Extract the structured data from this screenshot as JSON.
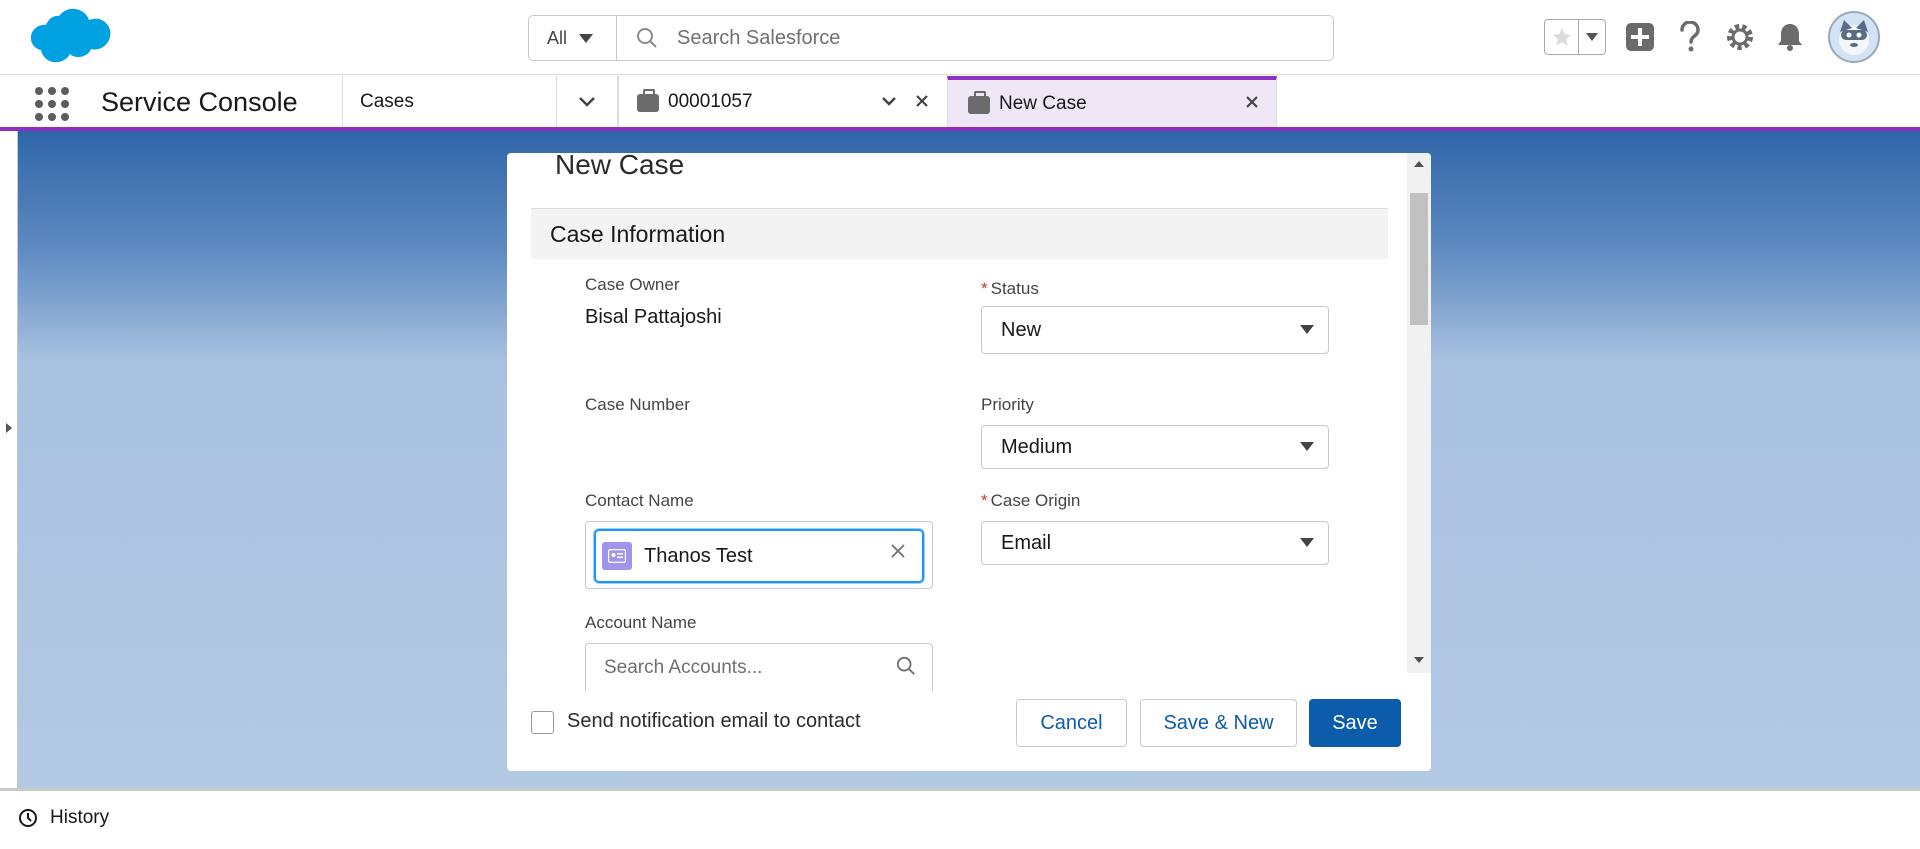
{
  "header": {
    "search_scope": "All",
    "search_placeholder": "Search Salesforce",
    "logo_icon": "salesforce-cloud-logo",
    "icons": [
      "star-icon",
      "chevron-down-icon",
      "add-icon",
      "help-icon",
      "setup-gear-icon",
      "notifications-bell-icon",
      "user-avatar"
    ]
  },
  "nav": {
    "app_name": "Service Console",
    "object_tab": "Cases",
    "tabs": [
      {
        "label": "00001057",
        "icon": "case-icon"
      },
      {
        "label": "New Case",
        "icon": "case-icon",
        "active": true
      }
    ]
  },
  "modal": {
    "title": "New Case",
    "section_title": "Case Information",
    "fields": {
      "case_owner": {
        "label": "Case Owner",
        "value": "Bisal Pattajoshi"
      },
      "status": {
        "label": "Status",
        "value": "New",
        "required": true
      },
      "case_number": {
        "label": "Case Number",
        "value": ""
      },
      "priority": {
        "label": "Priority",
        "value": "Medium"
      },
      "contact_name": {
        "label": "Contact Name",
        "value": "Thanos Test"
      },
      "case_origin": {
        "label": "Case Origin",
        "value": "Email",
        "required": true
      },
      "account_name": {
        "label": "Account Name",
        "placeholder": "Search Accounts..."
      }
    },
    "required_marker": "*",
    "notify_label": "Send notification email to contact",
    "buttons": {
      "cancel": "Cancel",
      "save_new": "Save & New",
      "save": "Save"
    }
  },
  "utility_bar": {
    "history_label": "History"
  },
  "colors": {
    "brand_purple": "#8e30c1",
    "primary_blue": "#0b5cab",
    "focus_blue": "#1b96ff",
    "salesforce_blue": "#00a1e0"
  }
}
